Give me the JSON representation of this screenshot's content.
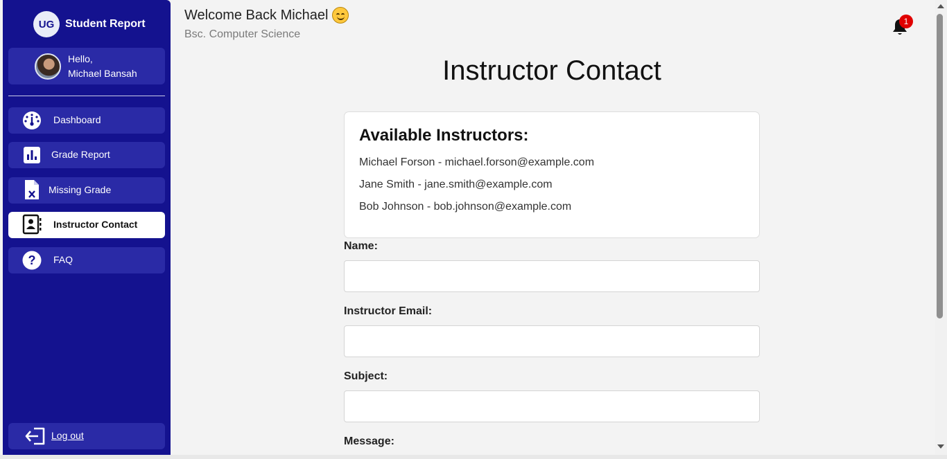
{
  "sidebar": {
    "brand_badge": "UG",
    "brand_title": "Student Report",
    "greeting": "Hello,",
    "user_name": "Michael Bansah",
    "nav": [
      {
        "label": "Dashboard",
        "icon": "dashboard-gauge-icon"
      },
      {
        "label": "Grade Report",
        "icon": "bar-chart-icon"
      },
      {
        "label": "Missing Grade",
        "icon": "file-x-icon"
      },
      {
        "label": "Instructor Contact",
        "icon": "contact-book-icon",
        "active": true
      },
      {
        "label": "FAQ",
        "icon": "question-circle-icon"
      }
    ],
    "logout_label": "Log out"
  },
  "header": {
    "welcome": "Welcome Back Michael",
    "program": "Bsc. Computer Science",
    "notification_count": "1"
  },
  "main": {
    "title": "Instructor Contact",
    "instructors_heading": "Available Instructors:",
    "instructors": [
      "Michael Forson - michael.forson@example.com",
      "Jane Smith - jane.smith@example.com",
      "Bob Johnson - bob.johnson@example.com"
    ],
    "form": {
      "name_label": "Name:",
      "email_label": "Instructor Email:",
      "subject_label": "Subject:",
      "message_label": "Message:",
      "name_value": "",
      "email_value": "",
      "subject_value": ""
    }
  },
  "colors": {
    "sidebar_bg": "#14128f",
    "nav_item_bg": "#2a2aa6",
    "badge_red": "#e00000",
    "page_bg": "#f3f3f3"
  }
}
